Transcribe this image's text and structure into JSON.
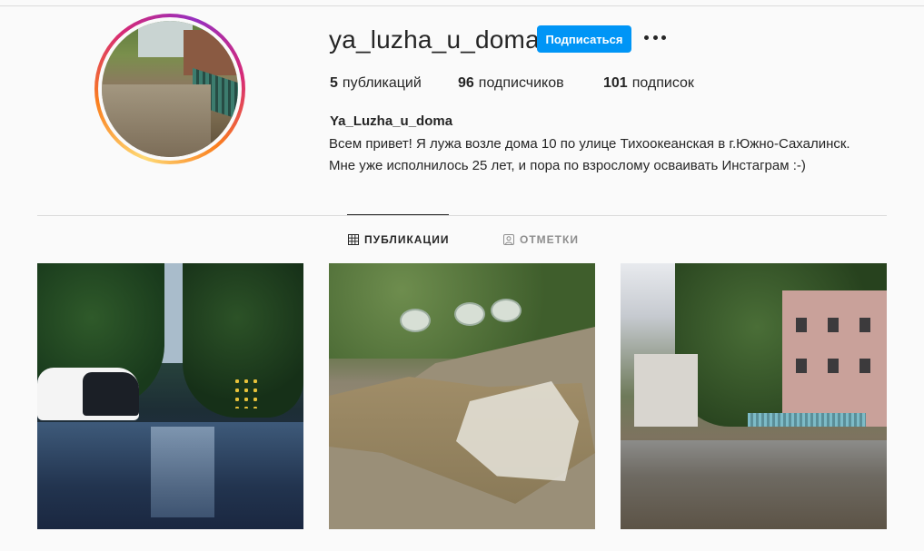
{
  "profile": {
    "username": "ya_luzha_u_doma",
    "follow_label": "Подписаться",
    "full_name": "Ya_Luzha_u_doma",
    "bio_lines": [
      "Всем привет! Я лужа возле дома 10 по улице Тихоокеанская в г.Южно-Сахалинск.",
      "Мне уже исполнилось 25 лет, и пора по взрослому осваивать Инстаграм :-)"
    ]
  },
  "stats": {
    "posts": {
      "count": "5",
      "label": "публикаций"
    },
    "followers": {
      "count": "96",
      "label": "подписчиков"
    },
    "following": {
      "count": "101",
      "label": "подписок"
    }
  },
  "tabs": [
    {
      "label": "ПУБЛИКАЦИИ",
      "icon": "grid-icon",
      "active": true
    },
    {
      "label": "ОТМЕТКИ",
      "icon": "tag-person-icon",
      "active": false
    }
  ],
  "colors": {
    "accent": "#0095f6",
    "text": "#262626",
    "muted": "#8e8e8e",
    "background": "#fafafa"
  },
  "posts": [
    {
      "subject": "flooded-street-night"
    },
    {
      "subject": "puddle-broken-asphalt"
    },
    {
      "subject": "puddle-apartment-yard"
    }
  ]
}
